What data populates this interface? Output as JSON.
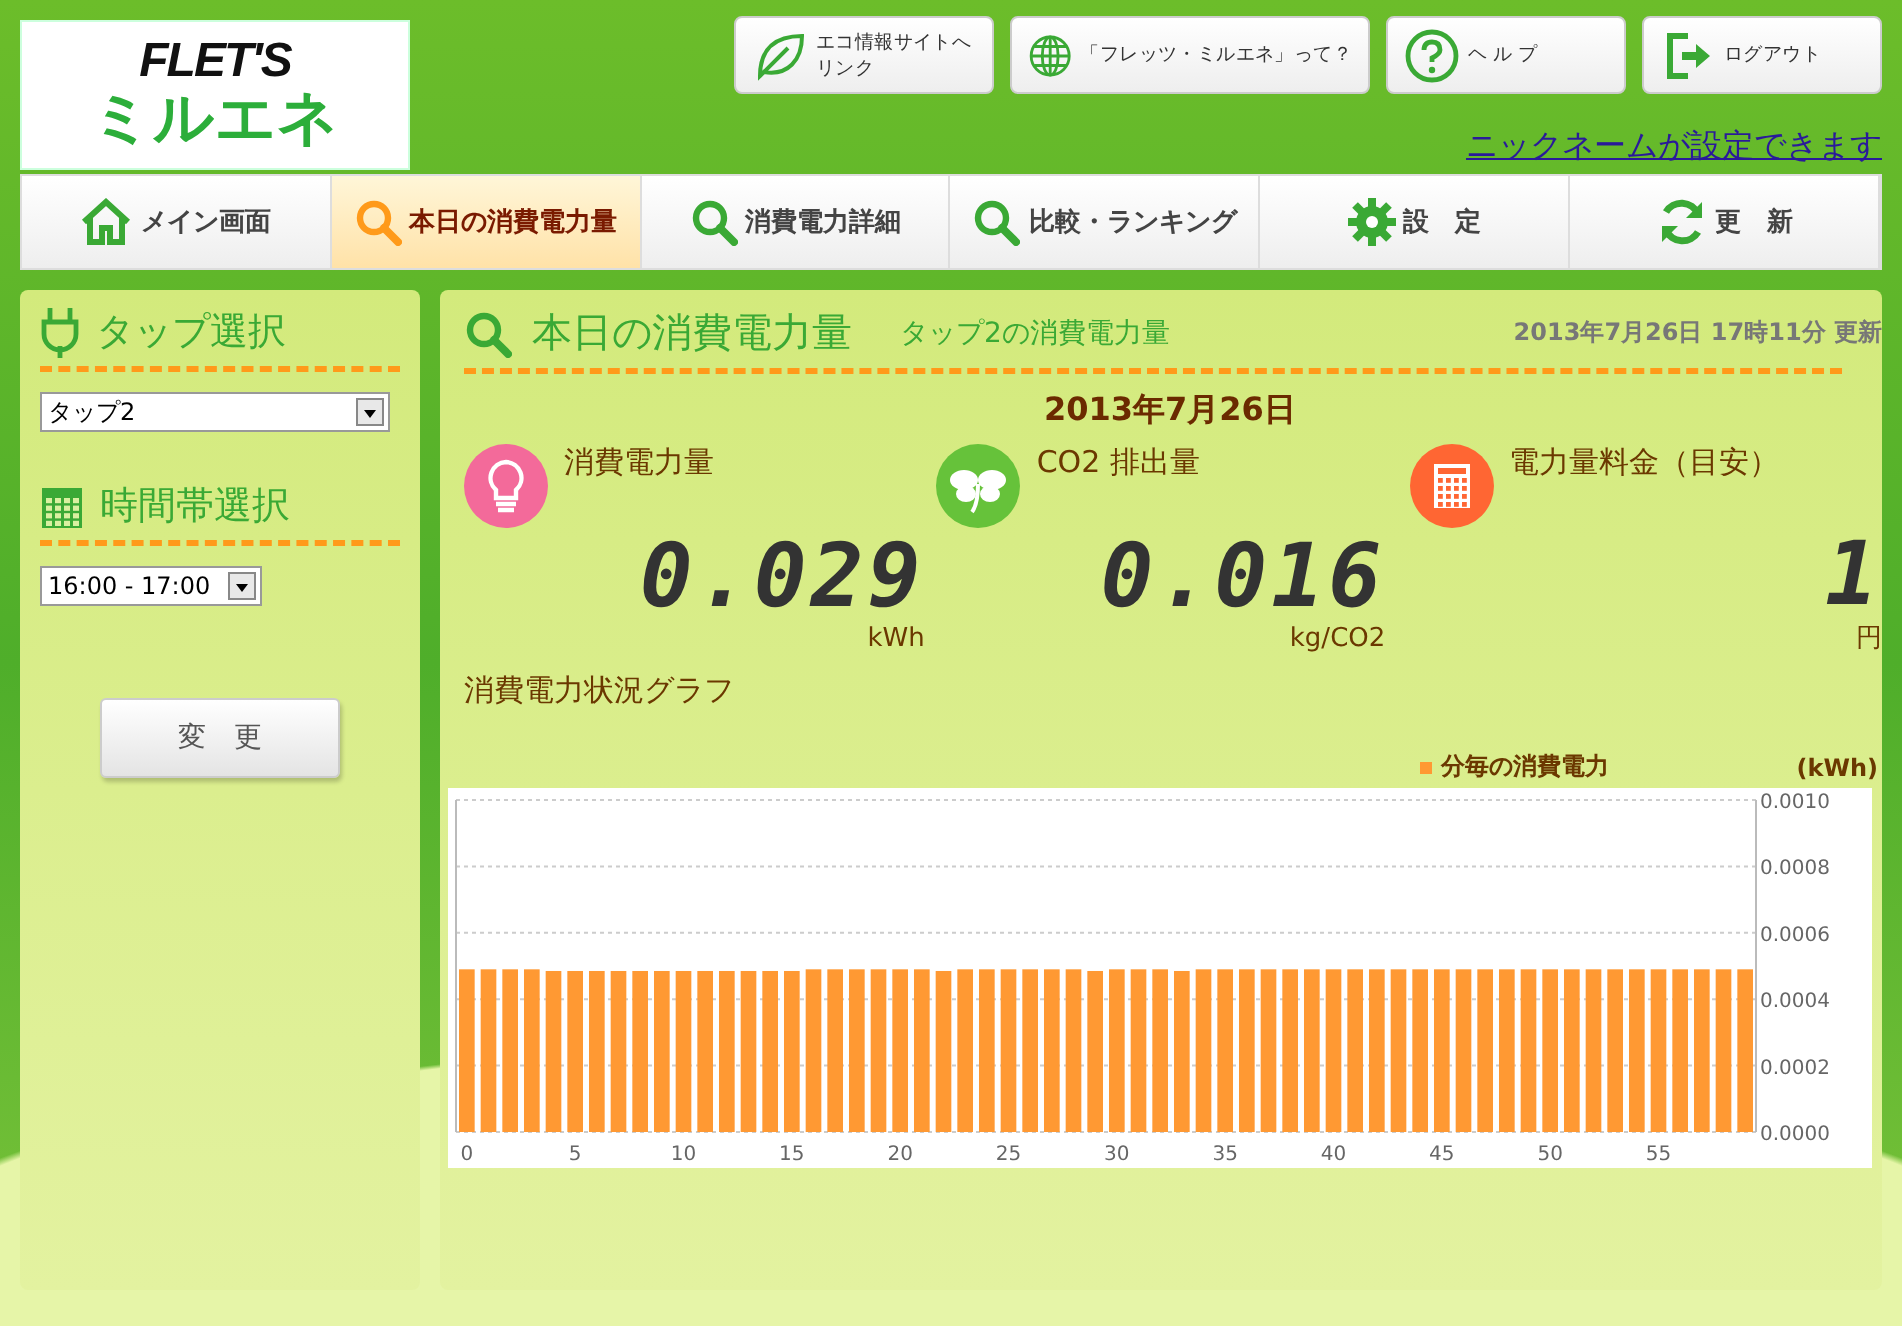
{
  "logo": {
    "line1": "FLET'S",
    "line2": "ミルエネ"
  },
  "top_buttons": [
    {
      "label": "エコ情報サイトへリンク"
    },
    {
      "label": "「フレッツ・ミルエネ」って？"
    },
    {
      "label": "ヘ ル プ"
    },
    {
      "label": "ログアウト"
    }
  ],
  "nickname_link": "ニックネームが設定できます",
  "nav_tabs": [
    {
      "label": "メイン画面",
      "selected": false
    },
    {
      "label": "本日の消費電力量",
      "selected": true
    },
    {
      "label": "消費電力詳細",
      "selected": false
    },
    {
      "label": "比較・ランキング",
      "selected": false
    },
    {
      "label": "設　定",
      "selected": false
    },
    {
      "label": "更　新",
      "selected": false
    }
  ],
  "sidebar": {
    "tap_title": "タップ選択",
    "tap_value": "タップ2",
    "time_title": "時間帯選択",
    "time_value": "16:00 - 17:00",
    "change_button": "変　更"
  },
  "main": {
    "title": "本日の消費電力量",
    "subtitle": "タップ2の消費電力量",
    "updated": "2013年7月26日 17時11分 更新",
    "date": "2013年7月26日",
    "metrics": [
      {
        "label": "消費電力量",
        "value": "0.029",
        "unit": "kWh"
      },
      {
        "label": "CO2 排出量",
        "value": "0.016",
        "unit": "kg/CO2"
      },
      {
        "label": "電力量料金（目安）",
        "value": "1",
        "unit": "円"
      }
    ],
    "graph_title": "消費電力状況グラフ",
    "chart_data": {
      "type": "bar",
      "ylabel": "(kWh)",
      "ylim": [
        0,
        0.001
      ],
      "yticks": [
        {
          "value": 0,
          "label": "0.0000"
        },
        {
          "value": 0.0002,
          "label": "0.0002"
        },
        {
          "value": 0.0004,
          "label": "0.0004"
        },
        {
          "value": 0.0006,
          "label": "0.0006"
        },
        {
          "value": 0.0008,
          "label": "0.0008"
        },
        {
          "value": 0.001,
          "label": "0.0010"
        }
      ],
      "grid": true,
      "x": [
        0,
        1,
        2,
        3,
        4,
        5,
        6,
        7,
        8,
        9,
        10,
        11,
        12,
        13,
        14,
        15,
        16,
        17,
        18,
        19,
        20,
        21,
        22,
        23,
        24,
        25,
        26,
        27,
        28,
        29,
        30,
        31,
        32,
        33,
        34,
        35,
        36,
        37,
        38,
        39,
        40,
        41,
        42,
        43,
        44,
        45,
        46,
        47,
        48,
        49,
        50,
        51,
        52,
        53,
        54,
        55,
        56,
        57,
        58,
        59
      ],
      "xticks": [
        0,
        5,
        10,
        15,
        20,
        25,
        30,
        35,
        40,
        45,
        50,
        55
      ],
      "xlim": [
        -0.5,
        59.5
      ],
      "series": [
        {
          "name": "分毎の消費電力",
          "color": "#ff9933",
          "values": [
            0.00049,
            0.00049,
            0.00049,
            0.00049,
            0.000485,
            0.000485,
            0.000485,
            0.000485,
            0.000485,
            0.000485,
            0.000485,
            0.000485,
            0.000485,
            0.000485,
            0.000485,
            0.000485,
            0.00049,
            0.00049,
            0.00049,
            0.00049,
            0.00049,
            0.00049,
            0.000485,
            0.00049,
            0.00049,
            0.00049,
            0.00049,
            0.00049,
            0.00049,
            0.000485,
            0.00049,
            0.00049,
            0.00049,
            0.000485,
            0.00049,
            0.00049,
            0.00049,
            0.00049,
            0.00049,
            0.00049,
            0.00049,
            0.00049,
            0.00049,
            0.00049,
            0.00049,
            0.00049,
            0.00049,
            0.00049,
            0.00049,
            0.00049,
            0.00049,
            0.00049,
            0.00049,
            0.00049,
            0.00049,
            0.00049,
            0.00049,
            0.00049,
            0.00049,
            0.00049
          ]
        }
      ]
    }
  }
}
